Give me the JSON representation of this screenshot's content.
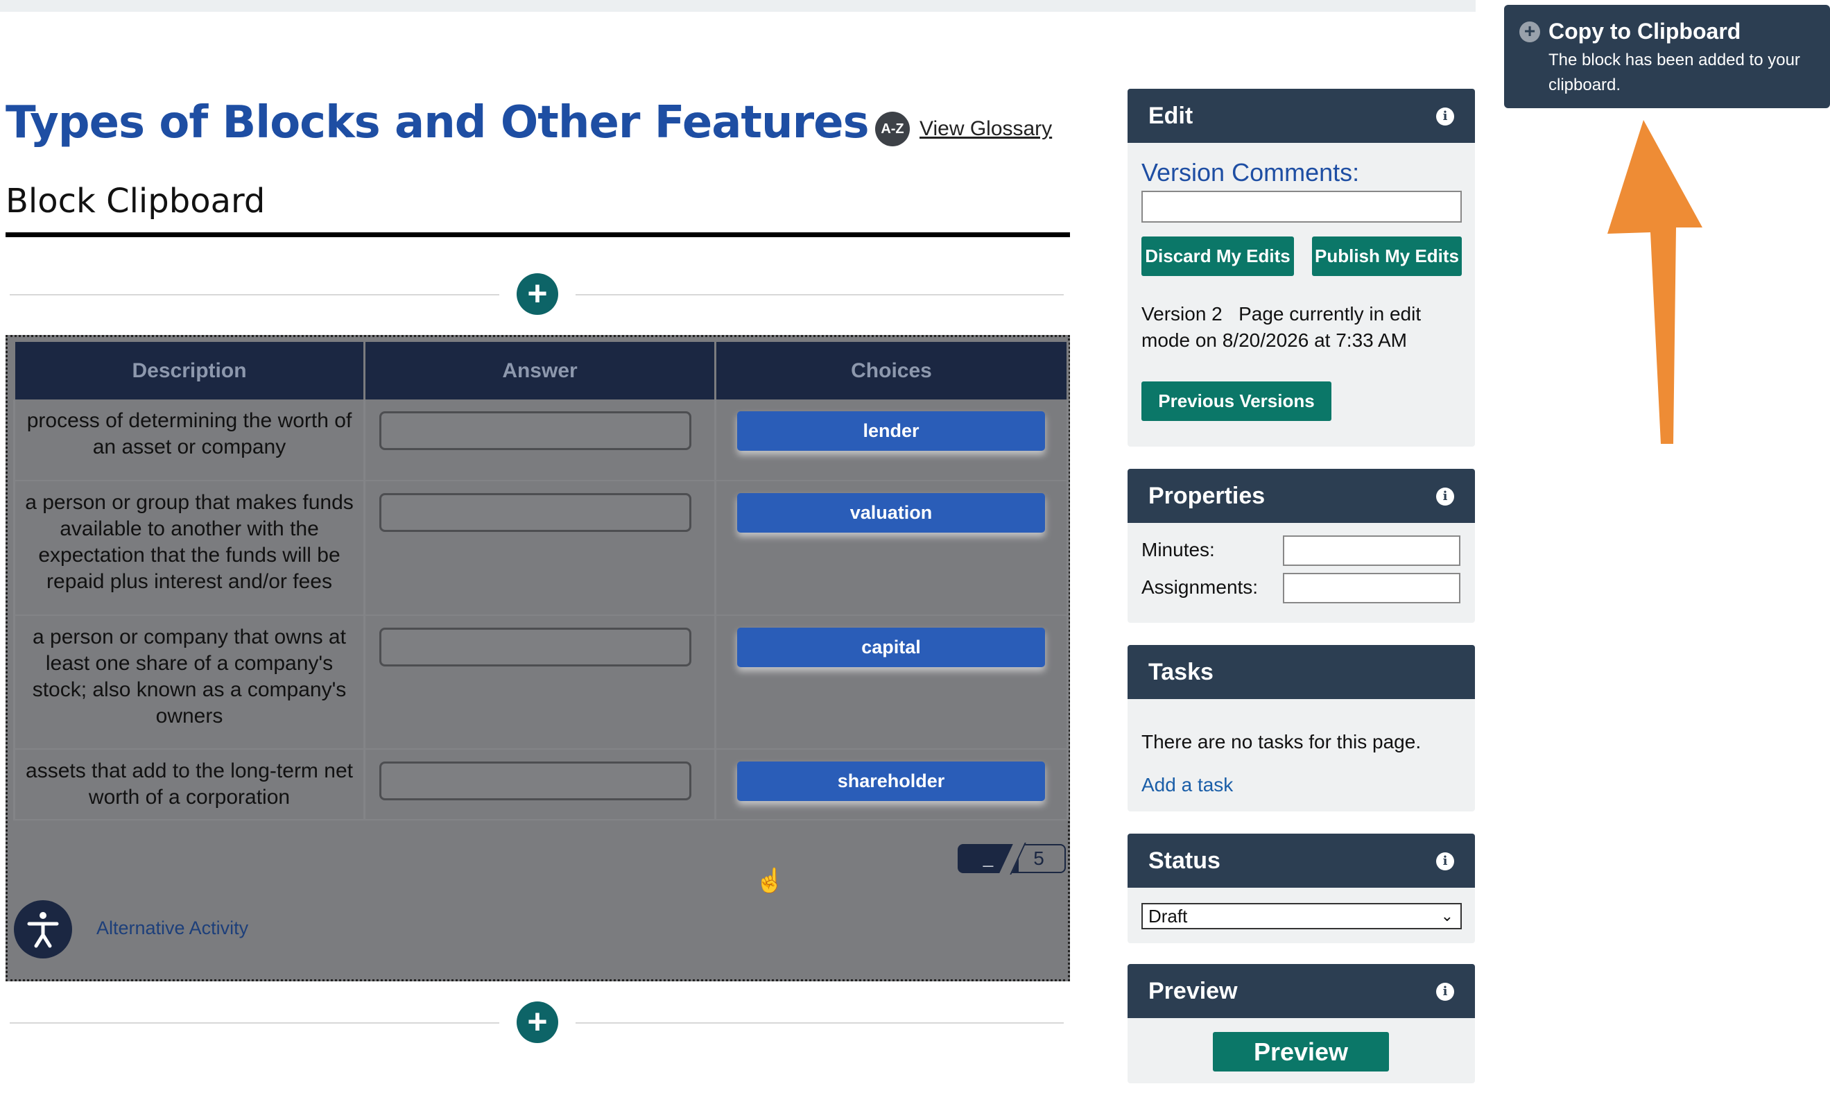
{
  "header": {
    "page_title": "Types of Blocks and Other Features",
    "glossary_badge": "A-Z",
    "glossary_link": "View Glossary",
    "section_title": "Block Clipboard"
  },
  "block": {
    "columns": [
      "Description",
      "Answer",
      "Choices"
    ],
    "rows": [
      {
        "description": "process of determining the worth of an asset or company",
        "choice": "lender"
      },
      {
        "description": "a person or group that makes funds available to another with the expectation that the funds will be repaid plus interest and/or fees",
        "choice": "valuation"
      },
      {
        "description": "a person or company that owns at least one share of a company's stock; also known as a company's owners",
        "choice": "capital"
      },
      {
        "description": "assets that add to the long-term net worth of a corporation",
        "choice": "shareholder"
      }
    ],
    "counter_current": "_",
    "counter_total": "5",
    "alternative_activity": "Alternative Activity"
  },
  "edit_panel": {
    "title": "Edit",
    "version_comments_label": "Version Comments:",
    "discard_label": "Discard My Edits",
    "publish_label": "Publish My Edits",
    "version_text": "Version 2   Page currently in edit mode on 8/20/2026 at 7:33 AM",
    "previous_versions_label": "Previous Versions"
  },
  "properties_panel": {
    "title": "Properties",
    "minutes_label": "Minutes:",
    "assignments_label": "Assignments:"
  },
  "tasks_panel": {
    "title": "Tasks",
    "empty_text": "There are no tasks for this page.",
    "add_task_label": "Add a task"
  },
  "status_panel": {
    "title": "Status",
    "selected": "Draft"
  },
  "preview_panel": {
    "title": "Preview",
    "button_label": "Preview"
  },
  "toast": {
    "title": "Copy to Clipboard",
    "message": "The block has been added to your clipboard."
  },
  "icons": {
    "info": "info-icon",
    "add": "plus-circle-icon",
    "accessibility": "accessibility-icon",
    "arrow_color": "#ee8c35"
  }
}
